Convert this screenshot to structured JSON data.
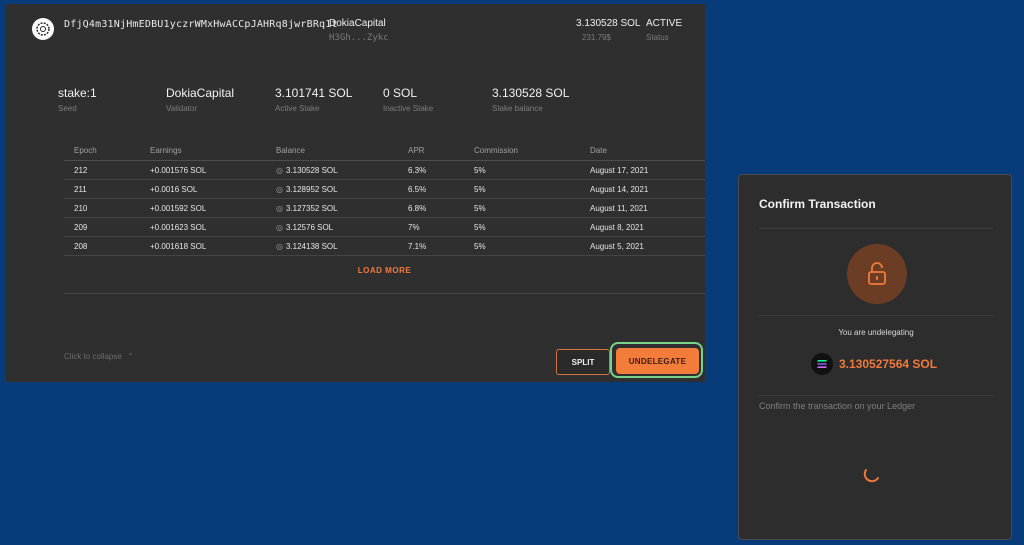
{
  "header": {
    "address": "DfjQ4m31NjHmEDBU1yczrWMxHwACCpJAHRq8jwrBRq1t",
    "validator": "DokiaCapital",
    "validator_short": "H3Gh...Zykc",
    "amount": "3.130528 SOL",
    "amount_usd": "231.79$",
    "status": "ACTIVE",
    "status_label": "Status"
  },
  "stats": [
    {
      "value": "stake:1",
      "label": "Seed"
    },
    {
      "value": "DokiaCapital",
      "label": "Validator"
    },
    {
      "value": "3.101741 SOL",
      "label": "Active Stake"
    },
    {
      "value": "0 SOL",
      "label": "Inactive Stake"
    },
    {
      "value": "3.130528 SOL",
      "label": "Stake balance"
    }
  ],
  "table": {
    "columns": [
      "Epoch",
      "Earnings",
      "Balance",
      "APR",
      "Commission",
      "Date"
    ],
    "rows": [
      [
        "212",
        "+0.001576 SOL",
        "3.130528 SOL",
        "6.3%",
        "5%",
        "August 17, 2021"
      ],
      [
        "211",
        "+0.0016 SOL",
        "3.128952 SOL",
        "6.5%",
        "5%",
        "August 14, 2021"
      ],
      [
        "210",
        "+0.001592 SOL",
        "3.127352 SOL",
        "6.8%",
        "5%",
        "August 11, 2021"
      ],
      [
        "209",
        "+0.001623 SOL",
        "3.12576 SOL",
        "7%",
        "5%",
        "August 8, 2021"
      ],
      [
        "208",
        "+0.001618 SOL",
        "3.124138 SOL",
        "7.1%",
        "5%",
        "August 5, 2021"
      ]
    ]
  },
  "load_more": "LOAD MORE",
  "collapse": "Click to collapse",
  "buttons": {
    "split": "SPLIT",
    "undelegate": "UNDELEGATE"
  },
  "modal": {
    "title": "Confirm Transaction",
    "undelegating": "You are undelegating",
    "amount": "3.130527564 SOL",
    "confirm_text": "Confirm the transaction on your Ledger"
  },
  "colors": {
    "accent": "#f37c3a",
    "background": "#073b7a",
    "panel": "#2f2f2f",
    "highlight": "#7ad38a"
  }
}
